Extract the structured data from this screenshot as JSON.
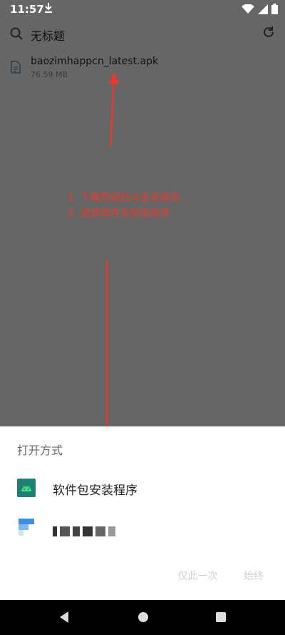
{
  "status_bar": {
    "time": "11:57",
    "icons": [
      "download-icon",
      "wifi-icon",
      "cellular-icon",
      "battery-icon"
    ]
  },
  "toolbar": {
    "title": "无标题"
  },
  "file": {
    "name": "baozimhappcn_latest.apk",
    "size": "76.59 MB"
  },
  "annotation": {
    "line1": "1. 下载完成后点击安装包",
    "line2": "2. 选择软件包安装程序",
    "color": "#e8392c"
  },
  "sheet": {
    "title": "打开方式",
    "options": [
      {
        "label": "软件包安装程序"
      },
      {
        "label": ""
      }
    ],
    "actions": {
      "just_once": "仅此一次",
      "always": "始终"
    }
  },
  "colors": {
    "overlay": "#666666",
    "accent": "#3ddc84",
    "annotation": "#e8392c"
  }
}
